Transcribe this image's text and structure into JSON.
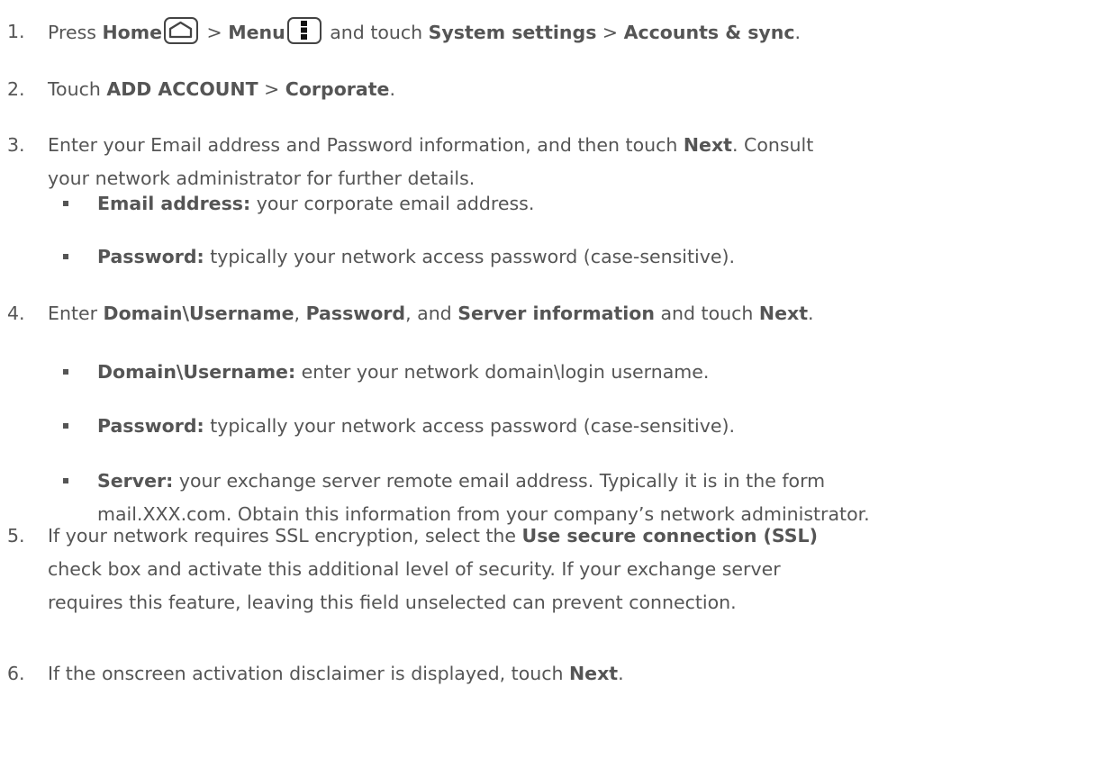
{
  "steps": [
    {
      "num": "1.",
      "lines": [
        {
          "parts": [
            {
              "t": "Press ",
              "b": false
            },
            {
              "t": "Home",
              "b": true
            },
            {
              "icon": "home-icon"
            },
            {
              "t": " > ",
              "b": false
            },
            {
              "t": "Menu",
              "b": true
            },
            {
              "icon": "menu-icon"
            },
            {
              "t": " and touch ",
              "b": false
            },
            {
              "t": "System settings",
              "b": true
            },
            {
              "t": " > ",
              "b": false
            },
            {
              "t": "Accounts & sync",
              "b": true
            },
            {
              "t": ".",
              "b": false
            }
          ]
        }
      ]
    },
    {
      "num": "2.",
      "lines": [
        {
          "parts": [
            {
              "t": "Touch ",
              "b": false
            },
            {
              "t": "ADD ACCOUNT",
              "b": true
            },
            {
              "t": " > ",
              "b": false
            },
            {
              "t": "Corporate",
              "b": true
            },
            {
              "t": ".",
              "b": false
            }
          ]
        }
      ]
    },
    {
      "num": "3.",
      "lines": [
        {
          "parts": [
            {
              "t": "Enter your Email address and Password information, and then touch ",
              "b": false
            },
            {
              "t": "Next",
              "b": true
            },
            {
              "t": ". Consult",
              "b": false
            }
          ]
        },
        {
          "parts": [
            {
              "t": "your network administrator for further details.",
              "b": false
            }
          ]
        }
      ],
      "bullets": [
        {
          "lines": [
            {
              "parts": [
                {
                  "t": "Email address:",
                  "b": true
                },
                {
                  "t": " your corporate email address.",
                  "b": false
                }
              ]
            }
          ]
        },
        {
          "lines": [
            {
              "parts": [
                {
                  "t": "Password:",
                  "b": true
                },
                {
                  "t": " typically your network access password (case-sensitive).",
                  "b": false
                }
              ]
            }
          ]
        }
      ]
    },
    {
      "num": "4.",
      "lines": [
        {
          "parts": [
            {
              "t": "Enter ",
              "b": false
            },
            {
              "t": "Domain\\Username",
              "b": true
            },
            {
              "t": ", ",
              "b": false
            },
            {
              "t": "Password",
              "b": true
            },
            {
              "t": ", and ",
              "b": false
            },
            {
              "t": "Server information",
              "b": true
            },
            {
              "t": " and touch ",
              "b": false
            },
            {
              "t": "Next",
              "b": true
            },
            {
              "t": ".",
              "b": false
            }
          ]
        }
      ],
      "bullets": [
        {
          "lines": [
            {
              "parts": [
                {
                  "t": "Domain\\Username:",
                  "b": true
                },
                {
                  "t": " enter your network domain\\login username.",
                  "b": false
                }
              ]
            }
          ]
        },
        {
          "lines": [
            {
              "parts": [
                {
                  "t": "Password:",
                  "b": true
                },
                {
                  "t": " typically your network access password (case-sensitive).",
                  "b": false
                }
              ]
            }
          ]
        },
        {
          "lines": [
            {
              "parts": [
                {
                  "t": "Server:",
                  "b": true
                },
                {
                  "t": " your exchange server remote email address. Typically it is in the form",
                  "b": false
                }
              ]
            },
            {
              "parts": [
                {
                  "t": "mail.XXX.com. Obtain this information from your company’s network administrator.",
                  "b": false
                }
              ]
            }
          ]
        }
      ]
    },
    {
      "num": "5.",
      "lines": [
        {
          "parts": [
            {
              "t": "If your network requires SSL encryption, select the ",
              "b": false
            },
            {
              "t": "Use secure connection (SSL)",
              "b": true
            }
          ]
        },
        {
          "parts": [
            {
              "t": "check box and activate this additional level of security. If your exchange server",
              "b": false
            }
          ]
        },
        {
          "parts": [
            {
              "t": "requires this feature, leaving this field unselected can prevent connection.",
              "b": false
            }
          ]
        }
      ]
    },
    {
      "num": "6.",
      "lines": [
        {
          "parts": [
            {
              "t": "If the onscreen activation disclaimer is displayed, touch ",
              "b": false
            },
            {
              "t": "Next",
              "b": true
            },
            {
              "t": ".",
              "b": false
            }
          ]
        }
      ]
    }
  ]
}
